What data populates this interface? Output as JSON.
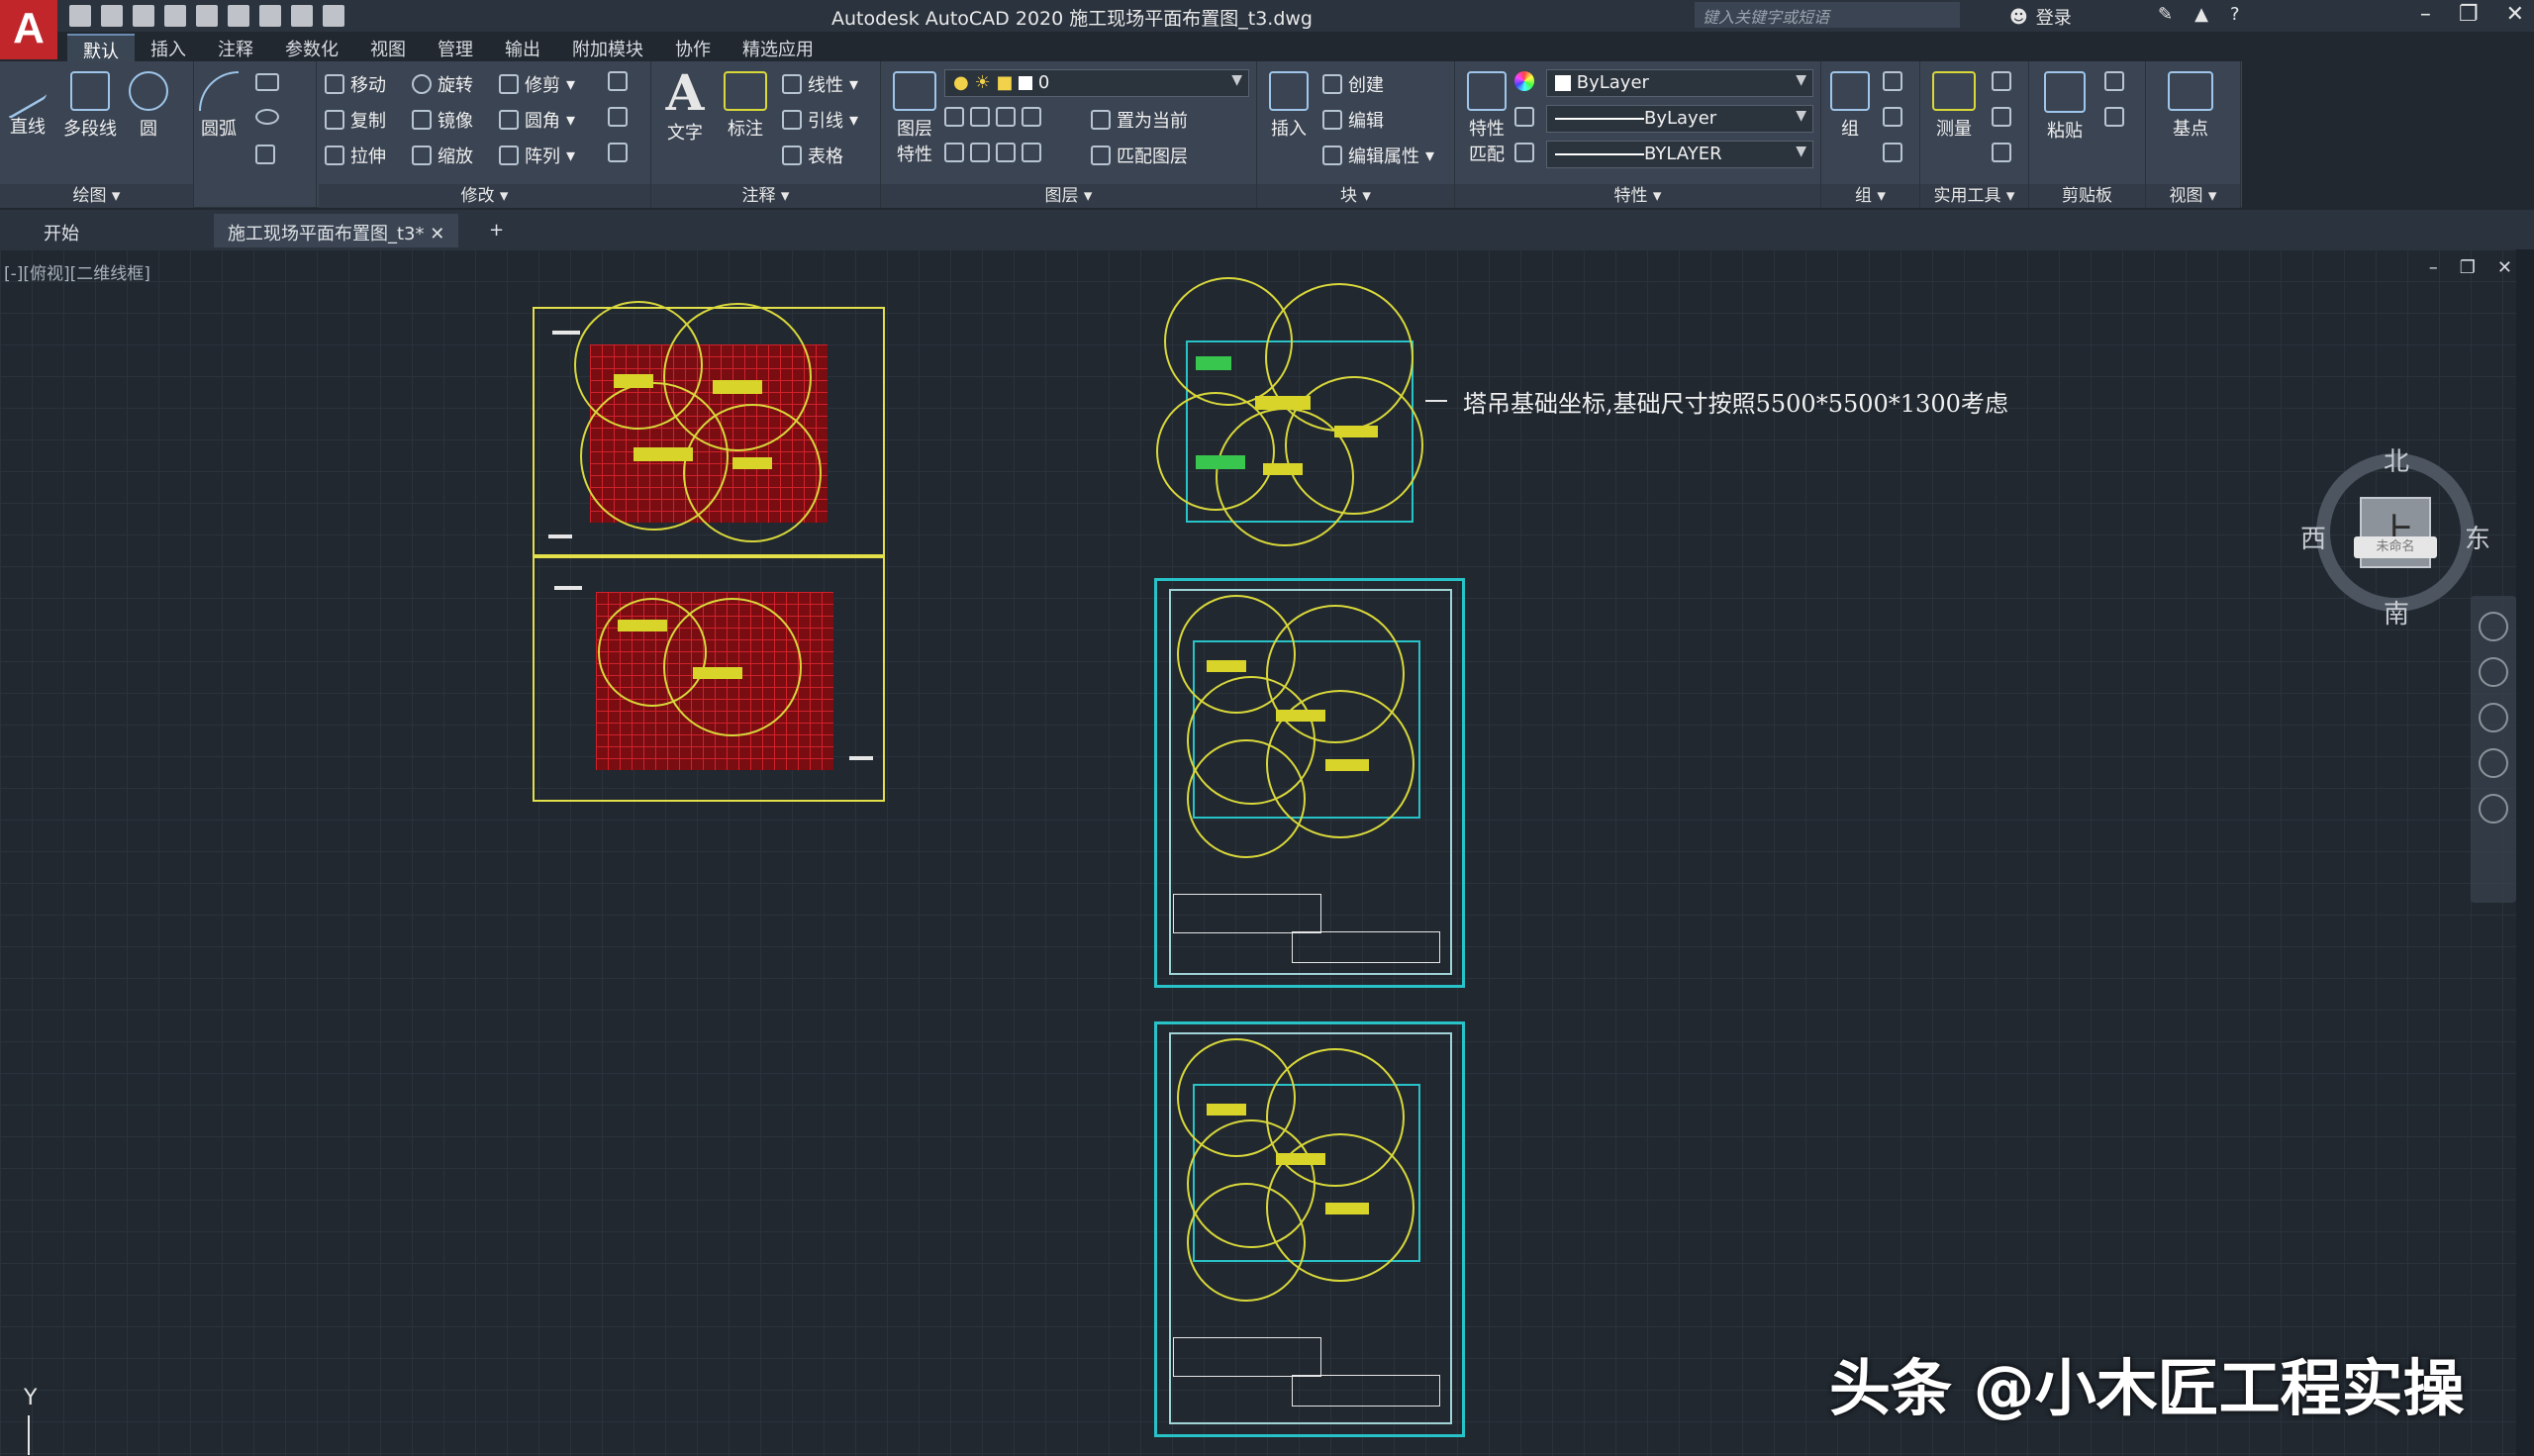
{
  "app": {
    "logo": "A",
    "window_title": "Autodesk AutoCAD 2020    施工现场平面布置图_t3.dwg",
    "search_placeholder": "键入关键字或短语",
    "login_label": "登录"
  },
  "ribbon_tabs": [
    "默认",
    "插入",
    "注释",
    "参数化",
    "视图",
    "管理",
    "输出",
    "附加模块",
    "协作",
    "精选应用"
  ],
  "ribbon": {
    "draw": {
      "title": "绘图",
      "line": "直线",
      "polyline": "多段线",
      "circle": "圆",
      "arc": "圆弧"
    },
    "modify": {
      "title": "修改",
      "move": "移动",
      "rotate": "旋转",
      "trim": "修剪",
      "copy": "复制",
      "mirror": "镜像",
      "fillet": "圆角",
      "stretch": "拉伸",
      "scale": "缩放",
      "array": "阵列"
    },
    "annotation": {
      "title": "注释",
      "text": "文字",
      "dimension": "标注",
      "linear": "线性",
      "leader": "引线",
      "table": "表格"
    },
    "layers": {
      "title": "图层",
      "layer_props_1": "图层",
      "layer_props_2": "特性",
      "current_layer": "0",
      "set_current": "置为当前",
      "match_layer": "匹配图层"
    },
    "block": {
      "title": "块",
      "insert": "插入",
      "create": "创建",
      "edit": "编辑",
      "edit_attr": "编辑属性"
    },
    "properties": {
      "title": "特性",
      "match_1": "特性",
      "match_2": "匹配",
      "color": "ByLayer",
      "linetype": "ByLayer",
      "lineweight": "BYLAYER"
    },
    "groups": {
      "title": "组",
      "group": "组"
    },
    "utilities": {
      "title": "实用工具",
      "measure": "测量"
    },
    "clipboard": {
      "title": "剪贴板",
      "paste": "粘贴"
    },
    "view": {
      "title": "视图",
      "base": "基点"
    }
  },
  "doc_tabs": {
    "start": "开始",
    "file": "施工现场平面布置图_t3*"
  },
  "viewport": {
    "label": "[-][俯视][二维线框]"
  },
  "drawing": {
    "annotation": "塔吊基础坐标,基础尺寸按照5500*5500*1300考虑"
  },
  "viewcube": {
    "north": "北",
    "south": "南",
    "east": "东",
    "west": "西",
    "top": "上",
    "wcs": "未命名"
  },
  "ucs": {
    "y": "Y"
  },
  "watermark": "头条 @小木匠工程实操"
}
